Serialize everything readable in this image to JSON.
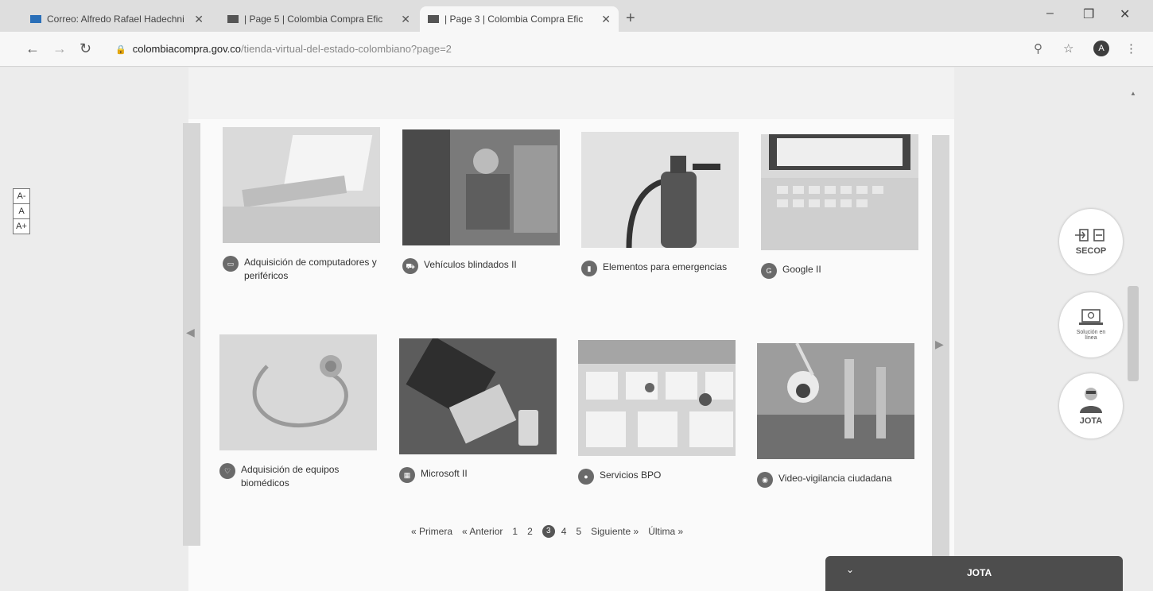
{
  "browser": {
    "tabs": [
      {
        "title": "Correo: Alfredo Rafael Hadechni",
        "active": false
      },
      {
        "title": "| Page 5 | Colombia Compra Efic",
        "active": false
      },
      {
        "title": "| Page 3 | Colombia Compra Efic",
        "active": true
      }
    ],
    "new_tab": "+",
    "url_host": "colombiacompra.gov.co",
    "url_path": "/tienda-virtual-del-estado-colombiano?page=2",
    "profile_initial": "A"
  },
  "accessibility": {
    "decrease": "A-",
    "normal": "A",
    "increase": "A+"
  },
  "products": [
    {
      "label": "Adquisición de computadores y periféricos"
    },
    {
      "label": "Vehículos blindados II"
    },
    {
      "label": "Elementos para emergencias"
    },
    {
      "label": "Google II"
    },
    {
      "label": "Adquisición de equipos biomédicos"
    },
    {
      "label": "Microsoft II"
    },
    {
      "label": "Servicios BPO"
    },
    {
      "label": "Video-vigilancia ciudadana"
    }
  ],
  "pager": {
    "first": "« Primera",
    "prev": "« Anterior",
    "pages": [
      "1",
      "2",
      "3",
      "4",
      "5"
    ],
    "current": "3",
    "next": "Siguiente »",
    "last": "Última »"
  },
  "side": {
    "secop": "SECOP",
    "solucion": "Solución en línea",
    "jota": "JOTA"
  },
  "chat": {
    "title": "JOTA"
  }
}
